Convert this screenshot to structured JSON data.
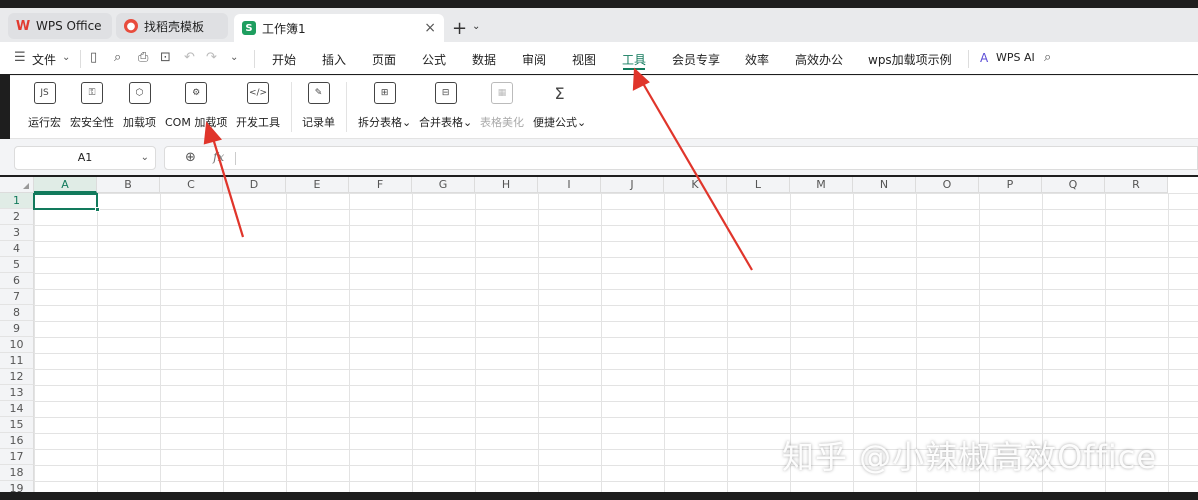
{
  "tabs": [
    {
      "label": "WPS Office",
      "icon": "wps-logo-icon"
    },
    {
      "label": "找稻壳模板",
      "icon": "docer-icon"
    },
    {
      "label": "工作簿1",
      "icon": "sheet-icon",
      "active": true
    }
  ],
  "tabbar": {
    "close_glyph": "×",
    "new_tab_glyph": "+",
    "menu_glyph": "⌄"
  },
  "menubar": {
    "file_label": "文件",
    "items": [
      "开始",
      "插入",
      "页面",
      "公式",
      "数据",
      "审阅",
      "视图",
      "工具",
      "会员专享",
      "效率",
      "高效办公",
      "wps加载项示例"
    ],
    "active_item": "工具",
    "ai_label": "WPS AI"
  },
  "ribbon": {
    "buttons": [
      {
        "label": "运行宏",
        "icon": "run-macro-icon"
      },
      {
        "label": "宏安全性",
        "icon": "macro-security-icon"
      },
      {
        "label": "加载项",
        "icon": "addin-icon"
      },
      {
        "label": "COM 加载项",
        "icon": "com-addin-icon"
      },
      {
        "label": "开发工具",
        "icon": "developer-tools-icon"
      },
      {
        "label": "记录单",
        "icon": "record-form-icon"
      },
      {
        "label": "拆分表格⌄",
        "icon": "split-table-icon"
      },
      {
        "label": "合并表格⌄",
        "icon": "merge-table-icon"
      },
      {
        "label": "表格美化",
        "icon": "table-beautify-icon",
        "disabled": true
      },
      {
        "label": "便捷公式⌄",
        "icon": "quick-formula-icon"
      }
    ]
  },
  "formula_bar": {
    "name_box": "A1",
    "fx": "fx",
    "value": ""
  },
  "sheet": {
    "columns": [
      "A",
      "B",
      "C",
      "D",
      "E",
      "F",
      "G",
      "H",
      "I",
      "J",
      "K",
      "L",
      "M",
      "N",
      "O",
      "P",
      "Q",
      "R"
    ],
    "rows": [
      "1",
      "2",
      "3",
      "4",
      "5",
      "6",
      "7",
      "8",
      "9",
      "10",
      "11",
      "12",
      "13",
      "14",
      "15",
      "16",
      "17",
      "18",
      "19"
    ],
    "selected_cell": "A1"
  },
  "watermark": "知乎 @小辣椒高效Office",
  "colors": {
    "accent": "#127a5c",
    "annotation_arrow": "#e0352b"
  }
}
